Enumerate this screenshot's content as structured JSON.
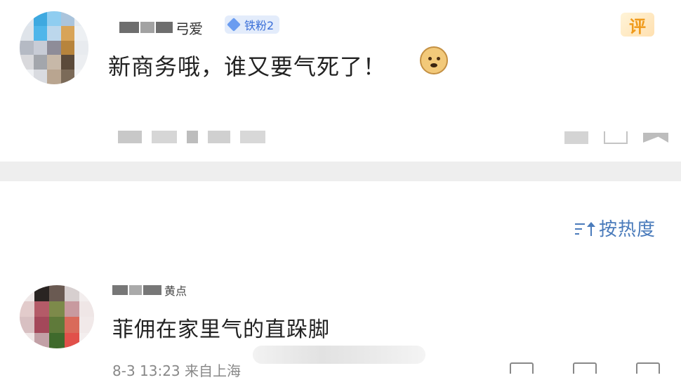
{
  "post": {
    "username_suffix": "弓爱",
    "badge": "铁粉2",
    "text": "新商务哦，谁又要气死了！",
    "emoji": "doge-emoji",
    "comment_tag": "评"
  },
  "sort": {
    "icon": "sort-icon",
    "label": "按热度"
  },
  "comment": {
    "username_suffix": "黄点",
    "text": "菲佣在家里气的直跺脚",
    "meta": "8-3 13:23 来自上海"
  }
}
